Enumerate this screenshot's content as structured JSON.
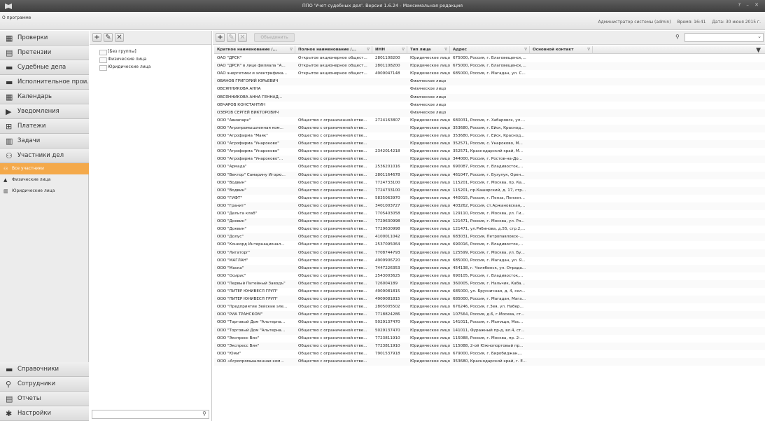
{
  "window": {
    "title": "ППО 'Учет судебных дел'. Версия 1.6.24 - Максимальная редакция",
    "controls": "? – ✕"
  },
  "menubar": {
    "about": "О программе",
    "user": "Администратор системы (admin)",
    "time": "Время: 16:41",
    "date": "Дата: 30 июня 2015 г."
  },
  "nav": {
    "top": [
      {
        "label": "Проверки",
        "icon": "checks-icon",
        "color": "#3a3a3a"
      },
      {
        "label": "Претензии",
        "icon": "claims-icon",
        "color": "#3a3a3a"
      },
      {
        "label": "Судебные дела",
        "icon": "folder-icon",
        "color": "#3a3a3a"
      },
      {
        "label": "Исполнительное прои...",
        "icon": "folder-icon",
        "color": "#3a3a3a"
      },
      {
        "label": "Календарь",
        "icon": "calendar-icon",
        "color": "#3a3a3a"
      },
      {
        "label": "Уведомления",
        "icon": "notification-icon",
        "color": "#3a3a3a"
      },
      {
        "label": "Платежи",
        "icon": "payments-icon",
        "color": "#3a3a3a"
      },
      {
        "label": "Задачи",
        "icon": "tasks-icon",
        "color": "#3a3a3a"
      },
      {
        "label": "Участники дел",
        "icon": "participants-icon",
        "color": "#3a3a3a"
      }
    ],
    "sub": [
      {
        "label": "Все участники",
        "icon": "all-participants-icon",
        "active": true
      },
      {
        "label": "Физические лица",
        "icon": "person-icon",
        "active": false
      },
      {
        "label": "Юридические лица",
        "icon": "building-icon",
        "active": false
      }
    ],
    "bottom": [
      {
        "label": "Справочники",
        "icon": "directory-icon"
      },
      {
        "label": "Сотрудники",
        "icon": "employees-icon"
      },
      {
        "label": "Отчеты",
        "icon": "reports-icon"
      },
      {
        "label": "Настройки",
        "icon": "settings-icon"
      }
    ]
  },
  "groups": {
    "items": [
      "[Без группы]",
      "Физические лица",
      "Юридические лица"
    ]
  },
  "toolbar": {
    "add": "+",
    "edit": "✎",
    "delete": "✕",
    "wide_button": "Объединить",
    "search_value": ""
  },
  "grid": {
    "columns": [
      "Краткое наименование /...",
      "Полное наименование /...",
      "ИНН",
      "Тип лица",
      "Адрес",
      "Основной контакт"
    ],
    "rows": [
      [
        "ОАО \"ДРСК\"",
        "Открытое акционерное общест...",
        "2801108200",
        "Юридическое лицо",
        "675000, Россия, г. Благовещенск,..."
      ],
      [
        "ОАО \"ДРСК\" в лице филиала \"А...",
        "Открытое акционерное общест...",
        "2801108200",
        "Юридическое лицо",
        "675000, Россия, г. Благовещенск,..."
      ],
      [
        "ОАО энергетики и электрифика...",
        "Открытое акционерное общест...",
        "4909047148",
        "Юридическое лицо",
        "685000, Россия, г. Магадан, ул. С..."
      ],
      [
        "ОВАНОВ ГРИГОРИЙ ЮРЬЕВИЧ",
        "",
        "",
        "Физическое лицо",
        ""
      ],
      [
        "ОВСЯННИКОВА АННА",
        "",
        "",
        "Физическое лицо",
        ""
      ],
      [
        "ОВСЯННИКОВА АННА ГЕННАД...",
        "",
        "",
        "Физическое лицо",
        ""
      ],
      [
        "ОВЧАРОВ КОНСТАНТИН",
        "",
        "",
        "Физическое лицо",
        ""
      ],
      [
        "ОЗЕРОВ СЕРГЕЙ ВИКТОРОВИЧ",
        "",
        "",
        "Физическое лицо",
        ""
      ],
      [
        "ООО \"Авиапарк\"",
        "Общество с ограниченной отве...",
        "2724163807",
        "Юридическое лицо",
        "680031, Россия, г. Хабаровск, ул...."
      ],
      [
        "ООО \"Агропромышленная ком...",
        "Общество с ограниченной отве...",
        "",
        "Юридическое лицо",
        "353680, Россия, г. Ейск, Краснод..."
      ],
      [
        "ООО \"Агрофирма \"Маяк\"",
        "Общество с ограниченной отве...",
        "",
        "Юридическое лицо",
        "353680, Россия, г. Ейск, Краснод..."
      ],
      [
        "ООО \"Агрофирма \"Унароково\"",
        "Общество с ограниченной отве...",
        "",
        "Юридическое лицо",
        "352571, Россия, с. Унароково, М..."
      ],
      [
        "ООО \"Агрофирма \"Унароково\"",
        "Общество с ограниченной отве...",
        "2342014218",
        "Юридическое лицо",
        "352571, Краснодарский край, М..."
      ],
      [
        "ООО \"Агрофирма \"Унароково\"...",
        "Общество с ограниченной отве...",
        "",
        "Юридическое лицо",
        "344000, Россия, г. Ростов-на-До..."
      ],
      [
        "ООО \"Армада\"",
        "Общество с ограниченной отве...",
        "2536201016",
        "Юридическое лицо",
        "690087, Россия, г. Владивосток,..."
      ],
      [
        "ООО \"Вектор\" Самарину Игорю...",
        "Общество с ограниченной отве...",
        "2801164678",
        "Юридическое лицо",
        "461047, Россия, г. Бузулук, Орен..."
      ],
      [
        "ООО \"Водвин\"",
        "Общество с ограниченной отве...",
        "7724733100",
        "Юридическое лицо",
        "115201, Россия, г. Москва, пр. Ка..."
      ],
      [
        "ООО \"Водвин\"",
        "Общество с ограниченной отве...",
        "7724733100",
        "Юридическое лицо",
        "115201, пр.Каширский, д. 17, стр..."
      ],
      [
        "ООО \"ГИФТ\"",
        "Общество с ограниченной отве...",
        "5835063970",
        "Юридическое лицо",
        "440015, Россия, г. Пенза, Пензен..."
      ],
      [
        "ООО \"Гранит\"",
        "Общество с ограниченной отве...",
        "3401003727",
        "Юридическое лицо",
        "403262, Россия, ст.Аржановская,..."
      ],
      [
        "ООО \"Дельта клаб\"",
        "Общество с ограниченной отве...",
        "7705403058",
        "Юридическое лицо",
        "129110, Россия, г. Москва, ул. Ги..."
      ],
      [
        "ООО \"Доквин\"",
        "Общество с ограниченной отве...",
        "7729630998",
        "Юридическое лицо",
        "121471, Россия, г. Москва, ул. Ря..."
      ],
      [
        "ООО \"Доквин\"",
        "Общество с ограниченной отве...",
        "7729630998",
        "Юридическое лицо",
        "121471, ул.Рябинова, д.55, стр.2,..."
      ],
      [
        "ООО \"Долус\"",
        "Общество с ограниченной отве...",
        "4100011042",
        "Юридическое лицо",
        "683031, Россия, Петропавловск-..."
      ],
      [
        "ООО \"Конкорд Интернационал...",
        "Общество с ограниченной отве...",
        "2537095064",
        "Юридическое лицо",
        "690016, Россия, г. Владивосток,..."
      ],
      [
        "ООО \"Лигаторг\"",
        "Общество с ограниченной отве...",
        "7708744793",
        "Юридическое лицо",
        "125599, Россия, г. Москва, ул. Бу..."
      ],
      [
        "ООО \"МАГЛАН\"",
        "Общество с ограниченной отве...",
        "4909906720",
        "Юридическое лицо",
        "685000, Россия, г. Магадан, ул. Я..."
      ],
      [
        "ООО \"Маска\"",
        "Общество с ограниченной отве...",
        "7447226353",
        "Юридическое лицо",
        "454138, г. Челябинск, ул. Отрада..."
      ],
      [
        "ООО \"Осирис\"",
        "Общество с ограниченной отве...",
        "2543003625",
        "Юридическое лицо",
        "690105, Россия, г. Владивосток,..."
      ],
      [
        "ООО \"Первый Питейный Заводъ\"",
        "Общество с ограниченной отве...",
        "726004189",
        "Юридическое лицо",
        "360005, Россия, г. Нальчик, Каба..."
      ],
      [
        "ООО \"ПИТЕР ЮНИВЕСЛ ГРУП\"",
        "Общество с ограниченной отве...",
        "4909081815",
        "Юридическое лицо",
        "685000, ул. Брусничная, д. 4, скл..."
      ],
      [
        "ООО \"ПИТЕР ЮНИВЕСЛ ГРУП\"",
        "Общество с ограниченной отве...",
        "4909081815",
        "Юридическое лицо",
        "685000, Россия, г. Магадан, Мага..."
      ],
      [
        "ООО \"Предприятие Зейские эле...",
        "Общество с ограниченной отве...",
        "2805005502",
        "Юридическое лицо",
        "676246, Россия, г.Зея, ул. Набер..."
      ],
      [
        "ООО \"РИА ТРАНСКОМ\"",
        "Общество с ограниченной отве...",
        "7718824286",
        "Юридическое лицо",
        "107564, Россия, д.6, г.Москва, ст..."
      ],
      [
        "ООО \"Торговый Дом \"Альтерна...",
        "Общество с ограниченной отве...",
        "5029137470",
        "Юридическое лицо",
        "141011, Россия, г. Мытищи, Мос..."
      ],
      [
        "ООО \"Торговый Дом \"Альтерна...",
        "Общество с ограниченной отве...",
        "5029137470",
        "Юридическое лицо",
        "141011, Фуражный пр-д, вл.4, ст..."
      ],
      [
        "ООО \"Экспресс Вин\"",
        "Общество с ограниченной отве...",
        "7723811910",
        "Юридическое лицо",
        "115088, Россия, г. Москва, пр. 2-..."
      ],
      [
        "ООО \"Экспресс Вин\"",
        "Общество с ограниченной отве...",
        "7723811910",
        "Юридическое лицо",
        "115088, 2-ой Южнопортовый пр..."
      ],
      [
        "ООО \"Юми\"",
        "Общество с ограниченной отве...",
        "7901537918",
        "Юридическое лицо",
        "679000, Россия, г. Биробиджан,..."
      ],
      [
        "ООО «Агропромышленная ком...",
        "Общество с ограниченной отве...",
        "",
        "Юридическое лицо",
        "353680, Краснодарский край, г. Е..."
      ]
    ]
  }
}
